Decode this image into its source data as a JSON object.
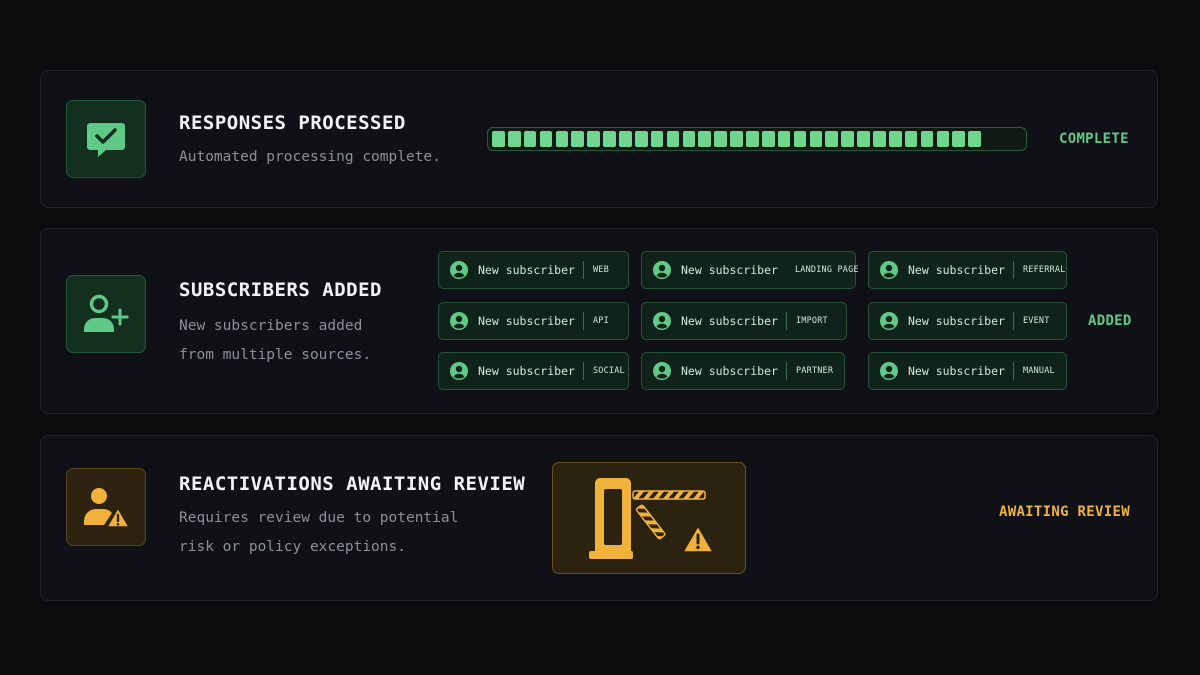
{
  "colors": {
    "background": "#0a0b0d",
    "card": "#0f1116",
    "success": "#5fc987",
    "success_fill": "#6fd58f",
    "warning": "#f0b23a"
  },
  "processed": {
    "icon": "chat-check-icon",
    "title": "RESPONSES PROCESSED",
    "description": "Automated processing complete.",
    "progress_percent": 100,
    "progress_segments": 31,
    "status": "COMPLETE"
  },
  "subscribers": {
    "icon": "user-add-icon",
    "title": "SUBSCRIBERS ADDED",
    "description": "New subscribers added from multiple sources.",
    "status": "ADDED",
    "chips": [
      {
        "label": "New subscriber",
        "source": "WEB"
      },
      {
        "label": "New subscriber",
        "source": "LANDING PAGE"
      },
      {
        "label": "New subscriber",
        "source": "REFERRAL"
      },
      {
        "label": "New subscriber",
        "source": "API"
      },
      {
        "label": "New subscriber",
        "source": "IMPORT"
      },
      {
        "label": "New subscriber",
        "source": "EVENT"
      },
      {
        "label": "New subscriber",
        "source": "SOCIAL"
      },
      {
        "label": "New subscriber",
        "source": "PARTNER"
      },
      {
        "label": "New subscriber",
        "source": "MANUAL"
      }
    ]
  },
  "reactivations": {
    "icon": "user-warning-icon",
    "illustration": "barrier-gate-warning-icon",
    "title": "REACTIVATIONS AWAITING REVIEW",
    "description": "Requires review due to potential risk or policy exceptions.",
    "status": "AWAITING REVIEW"
  }
}
